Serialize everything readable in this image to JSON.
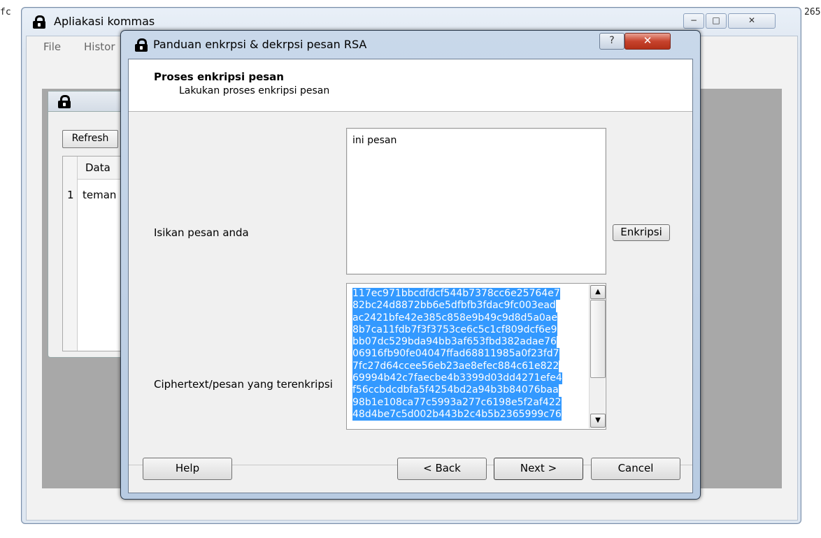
{
  "background": {
    "left_text": "fc",
    "right_text": "265"
  },
  "main_window": {
    "title": "Apliakasi kommas",
    "caption_minimize": "−",
    "caption_maximize": "□",
    "caption_close": "✕",
    "menu": [
      "File",
      "Histor"
    ],
    "inner_frame": {
      "refresh_label": "Refresh",
      "col_header": "Data",
      "row_num": "1",
      "row_value": "teman"
    }
  },
  "dialog": {
    "title": "Panduan enkrpsi & dekrpsi pesan RSA",
    "help_q": "?",
    "close_x": "✕",
    "header_title": "Proses enkripsi pesan",
    "header_subtitle": "Lakukan proses enkripsi pesan",
    "message_label": "Isikan pesan anda",
    "message_value": "ini pesan",
    "encrypt_button": "Enkripsi",
    "cipher_label": "Ciphertext/pesan yang terenkripsi",
    "cipher_lines": [
      "117ec971bbcdfdcf544b7378cc6e25764e7",
      "82bc24d8872bb6e5dfbfb3fdac9fc003ead",
      "ac2421bfe42e385c858e9b49c9d8d5a0ae",
      "8b7ca11fdb7f3f3753ce6c5c1cf809dcf6e9",
      "bb07dc529bda94bb3af653fbd382adae76",
      "06916fb90fe04047ffad68811985a0f23fd7",
      "7fc27d64ccee56eb23ae8efec884c61e822",
      "69994b42c7faecbe4b3399d03dd4271efe4",
      "f56ccbdcdbfa5f4254bd2a94b3b84076baa",
      "98b1e108ca77c5993a277c6198e5f2af422",
      "48d4be7c5d002b443b2c4b5b2365999c76"
    ],
    "scroll_up": "▲",
    "scroll_down": "▼",
    "buttons": {
      "help": "Help",
      "back": "< Back",
      "next": "Next >",
      "cancel": "Cancel"
    }
  }
}
